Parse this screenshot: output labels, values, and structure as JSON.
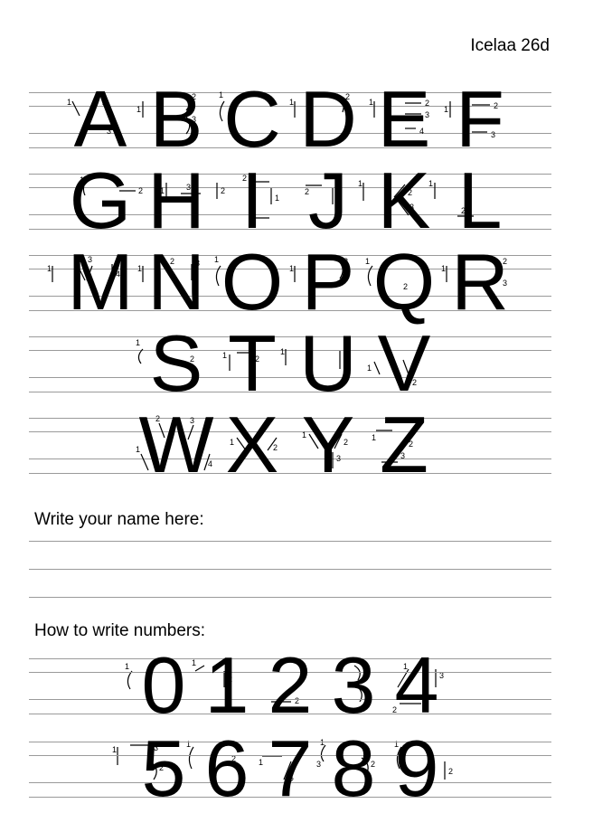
{
  "document": {
    "code": "Icelaa 26d"
  },
  "alphabet": {
    "rows": [
      [
        "A",
        "B",
        "C",
        "D",
        "E",
        "F"
      ],
      [
        "G",
        "H",
        "I",
        "J",
        "K",
        "L"
      ],
      [
        "M",
        "N",
        "O",
        "P",
        "Q",
        "R"
      ],
      [
        "S",
        "T",
        "U",
        "V"
      ],
      [
        "W",
        "X",
        "Y",
        "Z"
      ]
    ]
  },
  "name_section": {
    "label": "Write your name here:"
  },
  "numbers_section": {
    "label": "How to write numbers:",
    "rows": [
      [
        "0",
        "1",
        "2",
        "3",
        "4"
      ],
      [
        "5",
        "6",
        "7",
        "8",
        "9"
      ]
    ]
  }
}
